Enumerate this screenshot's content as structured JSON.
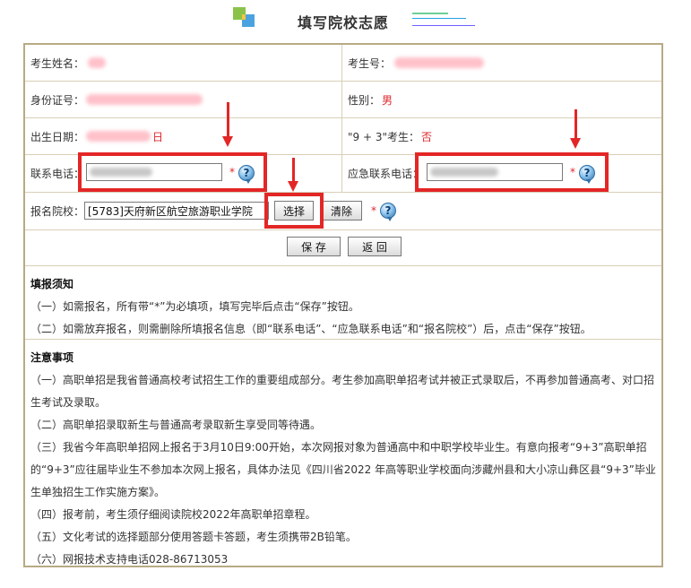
{
  "header": {
    "title": "填写院校志愿"
  },
  "form": {
    "name_label": "考生姓名：",
    "exam_no_label": "考生号：",
    "id_label": "身份证号：",
    "gender_label": "性别：",
    "gender_value": "男",
    "birth_label": "出生日期：",
    "birth_suffix": "日",
    "nine_three_label": "\"9 + 3\"考生：",
    "nine_three_value": "否",
    "phone_label": "联系电话：",
    "emergency_label": "应急联系电话：",
    "school_label": "报名院校：",
    "school_value": "[5783]天府新区航空旅游职业学院",
    "required_mark": "*",
    "help_glyph": "?",
    "select_button": "选择",
    "clear_button": "清除",
    "save_button": "保 存",
    "back_button": "返 回"
  },
  "notice": {
    "title": "填报须知",
    "items": [
      "（一）如需报名，所有带“*”为必填项，填写完毕后点击“保存”按钮。",
      "（二）如需放弃报名，则需删除所填报名信息（即“联系电话”、“应急联系电话”和“报名院校”）后，点击“保存”按钮。"
    ]
  },
  "attention": {
    "title": "注意事项",
    "items": [
      "（一）高职单招是我省普通高校考试招生工作的重要组成部分。考生参加高职单招考试并被正式录取后，不再参加普通高考、对口招生考试及录取。",
      "（二）高职单招录取新生与普通高考录取新生享受同等待遇。",
      "（三）我省今年高职单招网上报名于3月10日9:00开始，本次网报对象为普通高中和中职学校毕业生。有意向报考“9+3”高职单招的“9+3”应往届毕业生不参加本次网上报名，具体办法见《四川省2022 年高等职业学校面向涉藏州县和大小凉山彝区县“9+3”毕业生单独招生工作实施方案》。",
      "（四）报考前，考生须仔细阅读院校2022年高职单招章程。",
      "（五）文化考试的选择题部分使用答题卡答题，考生须携带2B铅笔。",
      "（六）网报技术支持电话028-86713053"
    ]
  },
  "colors": {
    "accent_red": "#e32626",
    "border": "#b7aa83",
    "value_red": "#e0252b"
  }
}
